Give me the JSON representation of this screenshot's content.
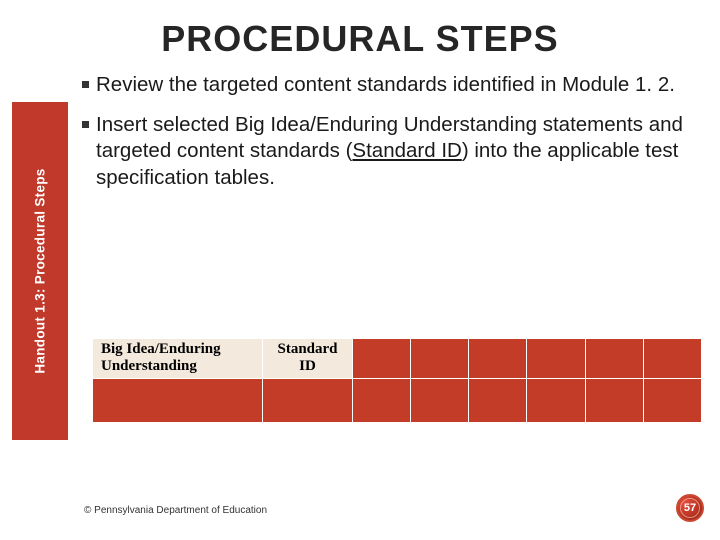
{
  "title": "PROCEDURAL STEPS",
  "sidebar": {
    "label": "Handout 1.3:  Procedural Steps"
  },
  "bullets": [
    {
      "text": "Review the targeted content standards identified in Module 1. 2."
    },
    {
      "p1": "Insert selected Big Idea/Enduring Understanding statements and targeted content standards (",
      "u1": "Standard ID",
      "p2": ") into the applicable test specification tables."
    }
  ],
  "table": {
    "headers": [
      "Big Idea/Enduring Understanding",
      "Standard ID"
    ]
  },
  "footer": "© Pennsylvania Department of Education",
  "page_number": "57"
}
